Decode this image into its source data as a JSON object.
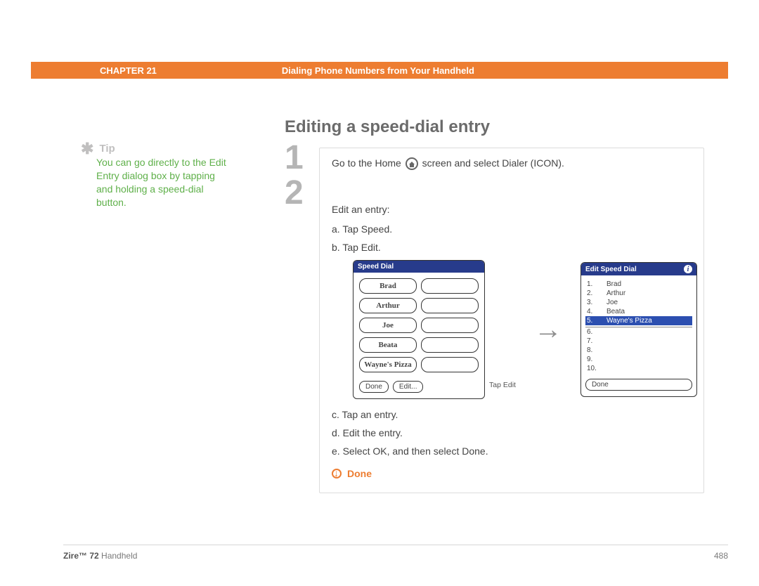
{
  "header": {
    "chapter_label": "CHAPTER 21",
    "title": "Dialing Phone Numbers from Your Handheld"
  },
  "tip": {
    "label": "Tip",
    "body": "You can go directly to the Edit Entry dialog box by tapping and holding a speed-dial button."
  },
  "section_title": "Editing a speed-dial entry",
  "steps": {
    "n1": "1",
    "n2": "2",
    "step1_a": "Go to the Home",
    "step1_b": "screen and select Dialer (ICON).",
    "step2_intro": "Edit an entry:",
    "sub_a": "a.  Tap Speed.",
    "sub_b": "b.  Tap Edit.",
    "sub_c": "c.  Tap an entry.",
    "sub_d": "d.  Edit the entry.",
    "sub_e": "e.  Select OK, and then select Done.",
    "done_label": "Done",
    "tap_edit_caption": "Tap Edit"
  },
  "speed_dial": {
    "title": "Speed Dial",
    "entries": [
      "Brad",
      "Arthur",
      "Joe",
      "Beata",
      "Wayne's Pizza"
    ],
    "done": "Done",
    "edit": "Edit..."
  },
  "edit_speed_dial": {
    "title": "Edit Speed Dial",
    "rows": [
      {
        "n": "1.",
        "name": "Brad"
      },
      {
        "n": "2.",
        "name": "Arthur"
      },
      {
        "n": "3.",
        "name": "Joe"
      },
      {
        "n": "4.",
        "name": "Beata"
      },
      {
        "n": "5.",
        "name": "Wayne's Pizza"
      },
      {
        "n": "6.",
        "name": ""
      },
      {
        "n": "7.",
        "name": ""
      },
      {
        "n": "8.",
        "name": ""
      },
      {
        "n": "9.",
        "name": ""
      },
      {
        "n": "10.",
        "name": ""
      }
    ],
    "selected_index": 4,
    "done": "Done"
  },
  "footer": {
    "product_bold": "Zire™ 72",
    "product_rest": " Handheld",
    "page": "488"
  }
}
